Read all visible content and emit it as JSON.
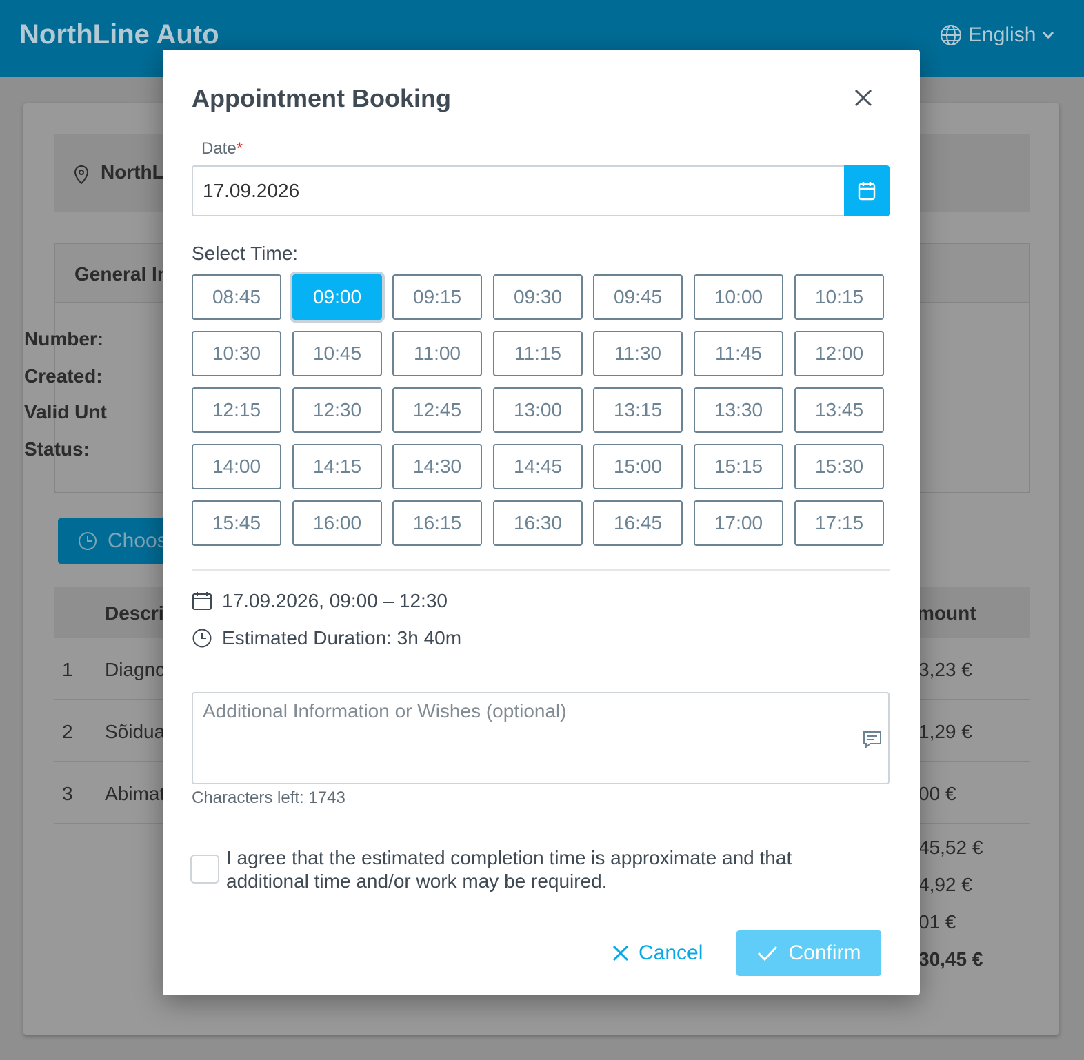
{
  "app": {
    "brand": "NorthLine Auto",
    "language": "English"
  },
  "background": {
    "location": "NorthL",
    "general_info_header": "General In",
    "fields": [
      "Number:",
      "Created:",
      "Valid Unt",
      "Status:"
    ],
    "choose_button": "Choos",
    "table": {
      "col_description": "Descri",
      "col_amount": "mount",
      "rows": [
        {
          "num": "1",
          "desc": "Diagnc",
          "amount": "3,23 €"
        },
        {
          "num": "2",
          "desc": "Sõidua",
          "amount": "1,29 €"
        },
        {
          "num": "3",
          "desc": "Abimat",
          "amount": "00 €"
        }
      ],
      "totals": [
        "45,52 €",
        "4,92 €",
        "01 €",
        "30,45 €"
      ]
    }
  },
  "modal": {
    "title": "Appointment Booking",
    "date_label": "Date",
    "date_required": "*",
    "date_value": "17.09.2026",
    "select_time_label": "Select Time:",
    "time_slots": [
      "08:45",
      "09:00",
      "09:15",
      "09:30",
      "09:45",
      "10:00",
      "10:15",
      "10:30",
      "10:45",
      "11:00",
      "11:15",
      "11:30",
      "11:45",
      "12:00",
      "12:15",
      "12:30",
      "12:45",
      "13:00",
      "13:15",
      "13:30",
      "13:45",
      "14:00",
      "14:15",
      "14:30",
      "14:45",
      "15:00",
      "15:15",
      "15:30",
      "15:45",
      "16:00",
      "16:15",
      "16:30",
      "16:45",
      "17:00",
      "17:15"
    ],
    "selected_slot": "09:00",
    "summary_datetime": "17.09.2026, 09:00 – 12:30",
    "estimated_duration": "Estimated Duration: 3h 40m",
    "notes_placeholder": "Additional Information or Wishes (optional)",
    "chars_left": "Characters left: 1743",
    "agree_text": "I agree that the estimated completion time is approximate and that additional time and/or work may be required.",
    "agree_checked": false,
    "cancel_label": "Cancel",
    "confirm_label": "Confirm",
    "colors": {
      "accent": "#06b2f3",
      "confirm_disabled": "#5fcdf7",
      "header": "#006c96"
    }
  }
}
